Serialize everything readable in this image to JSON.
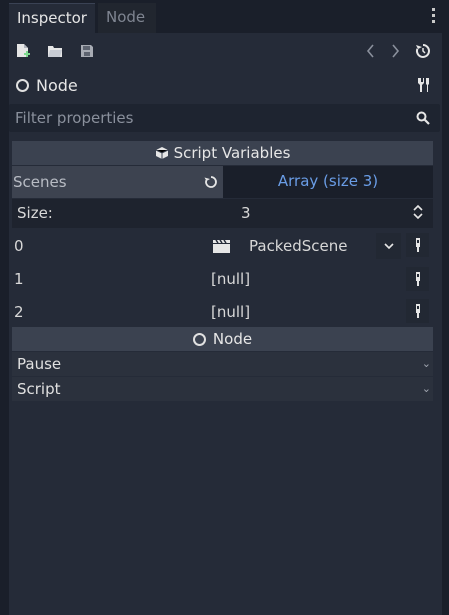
{
  "tabs": [
    {
      "label": "Inspector",
      "active": true
    },
    {
      "label": "Node",
      "active": false
    }
  ],
  "toolbar": {
    "icons": [
      "new-resource-icon",
      "open-resource-icon",
      "save-resource-icon",
      "history-back-icon",
      "history-forward-icon",
      "object-history-icon"
    ]
  },
  "node_header": {
    "label": "Node",
    "icon": "node-circle-icon",
    "settings_icon": "tools-icon"
  },
  "filter": {
    "placeholder": "Filter properties",
    "value": ""
  },
  "sections": {
    "script_variables": "Script Variables",
    "node": "Node"
  },
  "properties": {
    "scenes": {
      "label": "Scenes",
      "value": "Array (size 3)",
      "size_label": "Size:",
      "size_value": "3",
      "items": [
        {
          "index": "0",
          "value": "PackedScene"
        },
        {
          "index": "1",
          "value": "[null]"
        },
        {
          "index": "2",
          "value": "[null]"
        }
      ]
    },
    "node_groups": [
      {
        "label": "Pause"
      },
      {
        "label": "Script"
      }
    ]
  },
  "colors": {
    "background": "#1a1f2a",
    "panel": "#252b38",
    "section_header": "#3b4250",
    "accent_link": "#6a9de6",
    "add_icon_green": "#7dd98e"
  }
}
